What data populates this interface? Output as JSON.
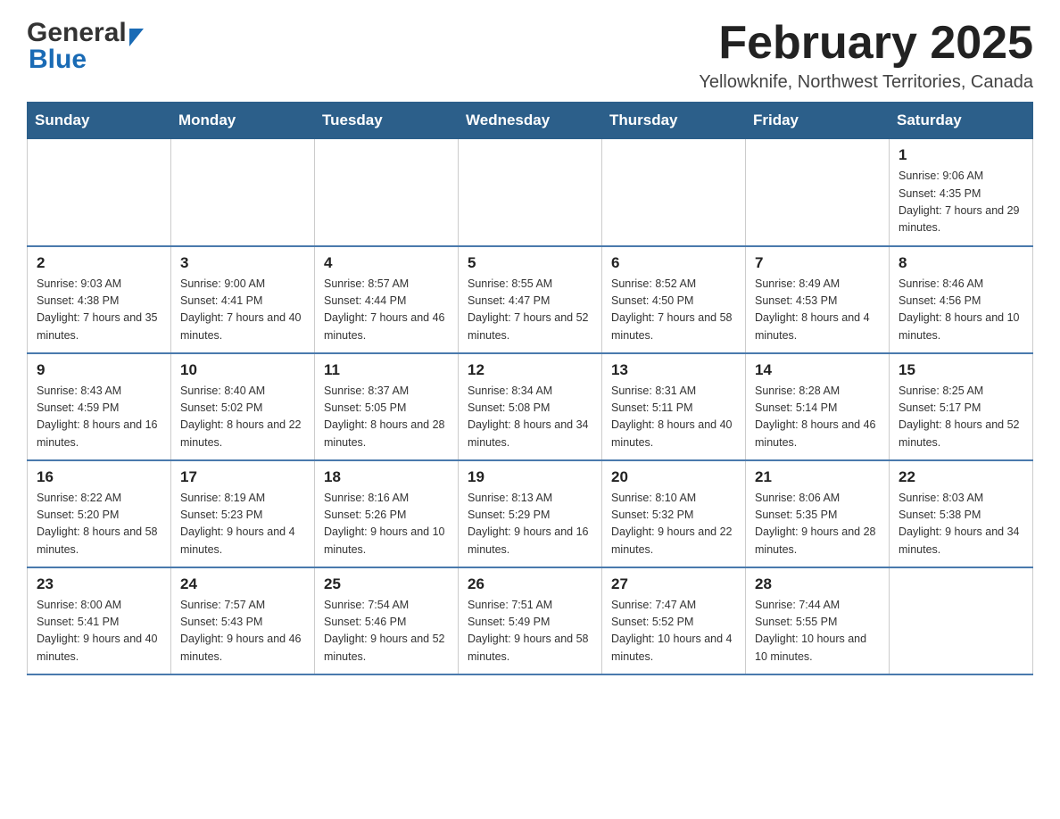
{
  "header": {
    "logo_general": "General",
    "logo_blue": "Blue",
    "month_title": "February 2025",
    "location": "Yellowknife, Northwest Territories, Canada"
  },
  "days_of_week": [
    "Sunday",
    "Monday",
    "Tuesday",
    "Wednesday",
    "Thursday",
    "Friday",
    "Saturday"
  ],
  "weeks": [
    [
      {
        "day": "",
        "info": ""
      },
      {
        "day": "",
        "info": ""
      },
      {
        "day": "",
        "info": ""
      },
      {
        "day": "",
        "info": ""
      },
      {
        "day": "",
        "info": ""
      },
      {
        "day": "",
        "info": ""
      },
      {
        "day": "1",
        "info": "Sunrise: 9:06 AM\nSunset: 4:35 PM\nDaylight: 7 hours and 29 minutes."
      }
    ],
    [
      {
        "day": "2",
        "info": "Sunrise: 9:03 AM\nSunset: 4:38 PM\nDaylight: 7 hours and 35 minutes."
      },
      {
        "day": "3",
        "info": "Sunrise: 9:00 AM\nSunset: 4:41 PM\nDaylight: 7 hours and 40 minutes."
      },
      {
        "day": "4",
        "info": "Sunrise: 8:57 AM\nSunset: 4:44 PM\nDaylight: 7 hours and 46 minutes."
      },
      {
        "day": "5",
        "info": "Sunrise: 8:55 AM\nSunset: 4:47 PM\nDaylight: 7 hours and 52 minutes."
      },
      {
        "day": "6",
        "info": "Sunrise: 8:52 AM\nSunset: 4:50 PM\nDaylight: 7 hours and 58 minutes."
      },
      {
        "day": "7",
        "info": "Sunrise: 8:49 AM\nSunset: 4:53 PM\nDaylight: 8 hours and 4 minutes."
      },
      {
        "day": "8",
        "info": "Sunrise: 8:46 AM\nSunset: 4:56 PM\nDaylight: 8 hours and 10 minutes."
      }
    ],
    [
      {
        "day": "9",
        "info": "Sunrise: 8:43 AM\nSunset: 4:59 PM\nDaylight: 8 hours and 16 minutes."
      },
      {
        "day": "10",
        "info": "Sunrise: 8:40 AM\nSunset: 5:02 PM\nDaylight: 8 hours and 22 minutes."
      },
      {
        "day": "11",
        "info": "Sunrise: 8:37 AM\nSunset: 5:05 PM\nDaylight: 8 hours and 28 minutes."
      },
      {
        "day": "12",
        "info": "Sunrise: 8:34 AM\nSunset: 5:08 PM\nDaylight: 8 hours and 34 minutes."
      },
      {
        "day": "13",
        "info": "Sunrise: 8:31 AM\nSunset: 5:11 PM\nDaylight: 8 hours and 40 minutes."
      },
      {
        "day": "14",
        "info": "Sunrise: 8:28 AM\nSunset: 5:14 PM\nDaylight: 8 hours and 46 minutes."
      },
      {
        "day": "15",
        "info": "Sunrise: 8:25 AM\nSunset: 5:17 PM\nDaylight: 8 hours and 52 minutes."
      }
    ],
    [
      {
        "day": "16",
        "info": "Sunrise: 8:22 AM\nSunset: 5:20 PM\nDaylight: 8 hours and 58 minutes."
      },
      {
        "day": "17",
        "info": "Sunrise: 8:19 AM\nSunset: 5:23 PM\nDaylight: 9 hours and 4 minutes."
      },
      {
        "day": "18",
        "info": "Sunrise: 8:16 AM\nSunset: 5:26 PM\nDaylight: 9 hours and 10 minutes."
      },
      {
        "day": "19",
        "info": "Sunrise: 8:13 AM\nSunset: 5:29 PM\nDaylight: 9 hours and 16 minutes."
      },
      {
        "day": "20",
        "info": "Sunrise: 8:10 AM\nSunset: 5:32 PM\nDaylight: 9 hours and 22 minutes."
      },
      {
        "day": "21",
        "info": "Sunrise: 8:06 AM\nSunset: 5:35 PM\nDaylight: 9 hours and 28 minutes."
      },
      {
        "day": "22",
        "info": "Sunrise: 8:03 AM\nSunset: 5:38 PM\nDaylight: 9 hours and 34 minutes."
      }
    ],
    [
      {
        "day": "23",
        "info": "Sunrise: 8:00 AM\nSunset: 5:41 PM\nDaylight: 9 hours and 40 minutes."
      },
      {
        "day": "24",
        "info": "Sunrise: 7:57 AM\nSunset: 5:43 PM\nDaylight: 9 hours and 46 minutes."
      },
      {
        "day": "25",
        "info": "Sunrise: 7:54 AM\nSunset: 5:46 PM\nDaylight: 9 hours and 52 minutes."
      },
      {
        "day": "26",
        "info": "Sunrise: 7:51 AM\nSunset: 5:49 PM\nDaylight: 9 hours and 58 minutes."
      },
      {
        "day": "27",
        "info": "Sunrise: 7:47 AM\nSunset: 5:52 PM\nDaylight: 10 hours and 4 minutes."
      },
      {
        "day": "28",
        "info": "Sunrise: 7:44 AM\nSunset: 5:55 PM\nDaylight: 10 hours and 10 minutes."
      },
      {
        "day": "",
        "info": ""
      }
    ]
  ]
}
